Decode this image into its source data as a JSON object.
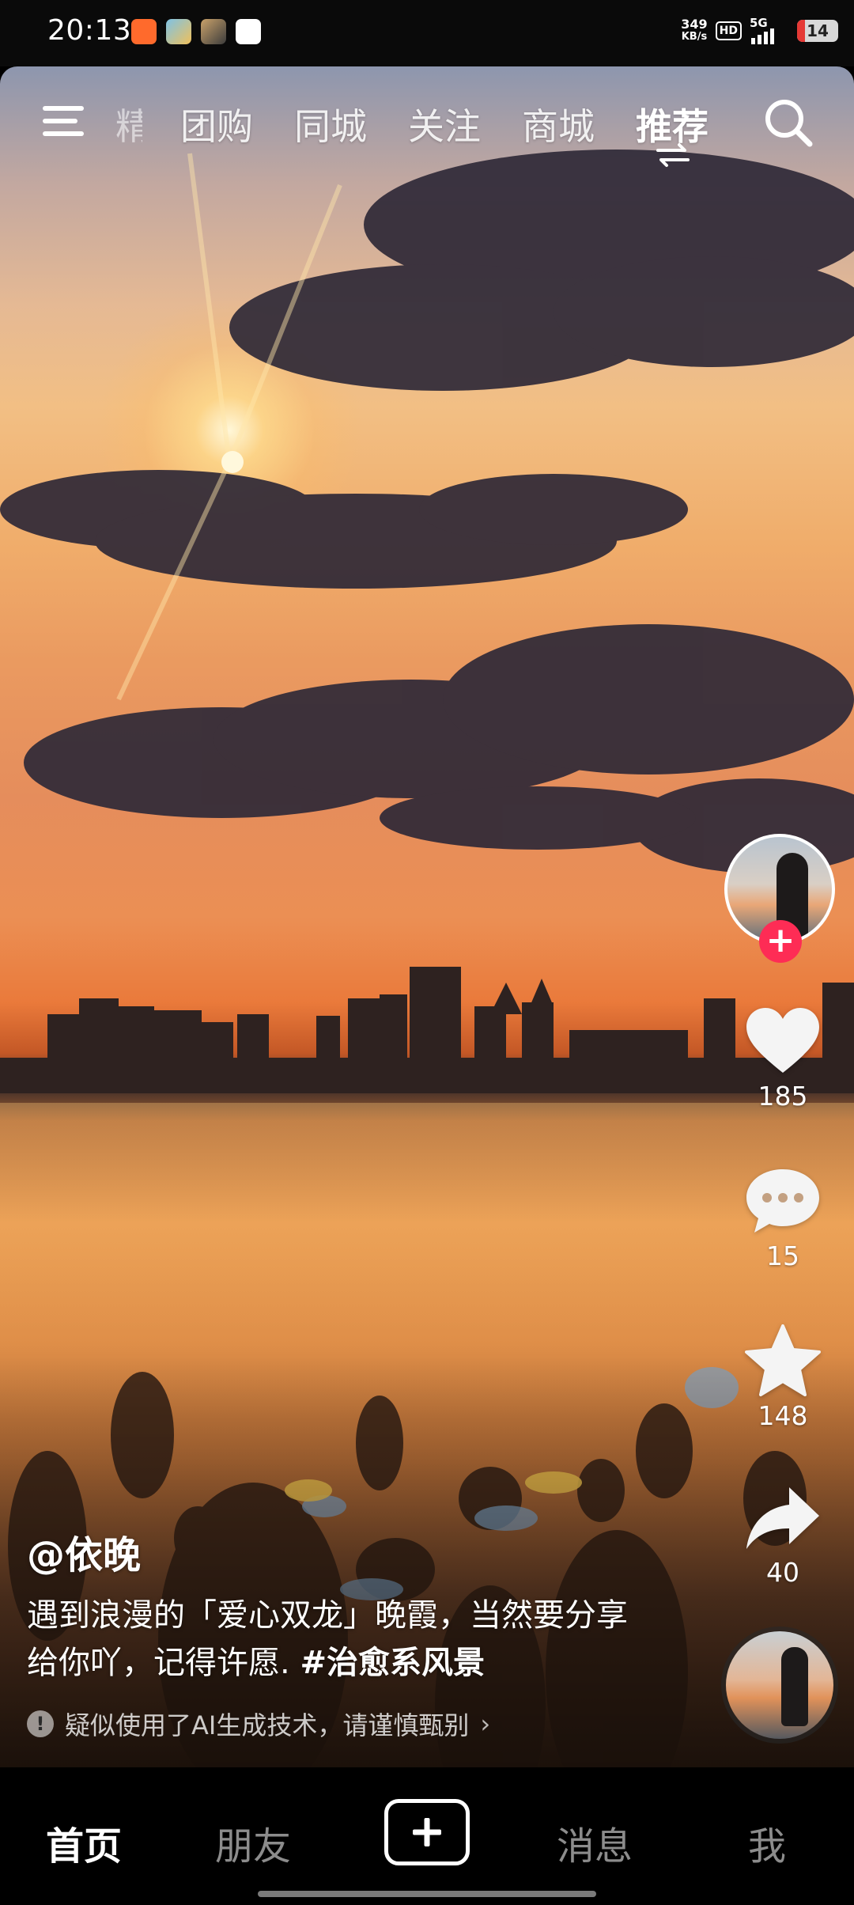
{
  "status_bar": {
    "time": "20:13",
    "net_speed_value": "349",
    "net_speed_unit": "KB/s",
    "hd": "HD",
    "network": "5G",
    "battery": "14",
    "battery_color": "#e53935"
  },
  "top_nav": {
    "partial_tab": "精选",
    "tabs": [
      "团购",
      "同城",
      "关注",
      "商城",
      "推荐"
    ],
    "active_tab": "推荐"
  },
  "video": {
    "author": "@依晚",
    "caption_text": "遇到浪漫的「爱心双龙」晚霞，当然要分享给你吖，记得许愿.",
    "hashtag": "#治愈系风景",
    "ai_notice": "疑似使用了AI生成技术，请谨慎甄别"
  },
  "actions": {
    "like_count": "185",
    "comment_count": "15",
    "favorite_count": "148",
    "share_count": "40",
    "follow_color": "#fe2c55"
  },
  "bottom_nav": {
    "items": [
      "首页",
      "朋友",
      "消息",
      "我"
    ],
    "active": "首页"
  }
}
